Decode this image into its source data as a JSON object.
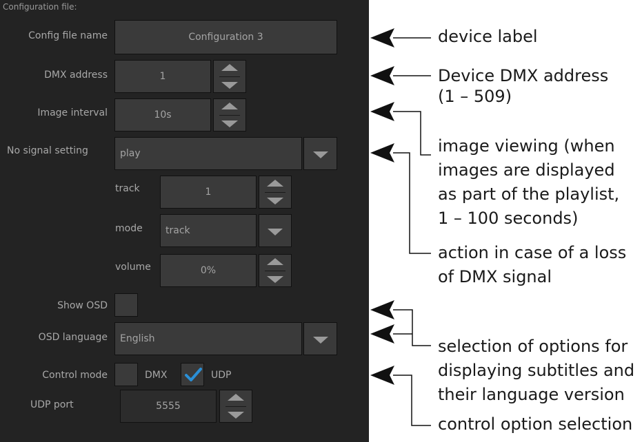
{
  "section_title": "Configuration file:",
  "config_file_name": {
    "label": "Config file name",
    "value": "Configuration 3"
  },
  "dmx_address": {
    "label": "DMX address",
    "value": "1"
  },
  "image_interval": {
    "label": "Image interval",
    "value": "10s"
  },
  "no_signal_setting": {
    "label": "No signal setting",
    "value": "play"
  },
  "track": {
    "label": "track",
    "value": "1"
  },
  "mode": {
    "label": "mode",
    "value": "track"
  },
  "volume": {
    "label": "volume",
    "value": "0%"
  },
  "show_osd": {
    "label": "Show OSD",
    "checked": false
  },
  "osd_language": {
    "label": "OSD language",
    "value": "English"
  },
  "control_mode": {
    "label": "Control mode",
    "options": [
      {
        "label": "DMX",
        "checked": false
      },
      {
        "label": "UDP",
        "checked": true
      }
    ]
  },
  "udp_port": {
    "label": "UDP port",
    "value": "5555"
  },
  "annotations": {
    "device_label": "device label",
    "dmx_address_1": "Device DMX address",
    "dmx_address_2": "(1 – 509)",
    "image_viewing_1": "image viewing (when",
    "image_viewing_2": "images are displayed",
    "image_viewing_3": "as part of the playlist,",
    "image_viewing_4": "1 – 100 seconds)",
    "loss_1": "action in case of a loss",
    "loss_2": "of DMX signal",
    "subtitles_1": "selection of options for",
    "subtitles_2": "displaying subtitles and",
    "subtitles_3": "their language version",
    "control": "control option selection"
  },
  "colors": {
    "panel_bg": "#232323",
    "field_bg": "#3a3a3a",
    "check_accent": "#2a8fd6"
  }
}
